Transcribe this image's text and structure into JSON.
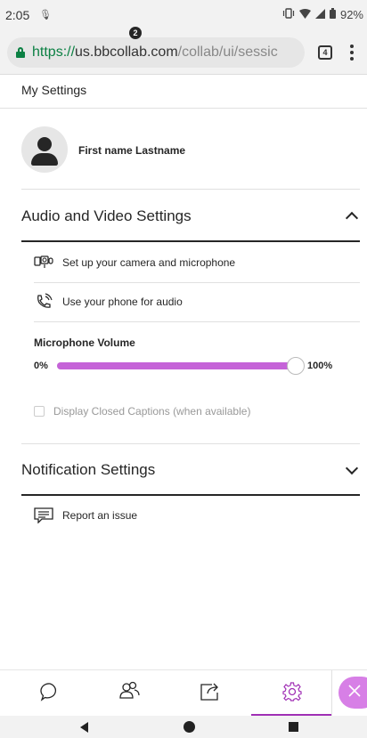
{
  "status_bar": {
    "time": "2:05",
    "battery": "92%"
  },
  "browser": {
    "url_scheme": "https://",
    "url_host": "us.bbcollab.com",
    "url_path": "/collab/ui/sessic",
    "tab_count": "4"
  },
  "settings": {
    "title": "My Settings",
    "user_name": "First name Lastname",
    "audio_video": {
      "title": "Audio and Video Settings",
      "camera_label": "Set up your camera and microphone",
      "phone_label": "Use your phone for audio",
      "mic_volume_label": "Microphone Volume",
      "mic_min": "0%",
      "mic_max": "100%",
      "mic_level": 1.0,
      "captions_label": "Display Closed Captions (when available)"
    },
    "notifications": {
      "title": "Notification Settings",
      "report_label": "Report an issue"
    }
  },
  "bottom_nav": {
    "attendee_badge": "2",
    "active": "settings"
  },
  "colors": {
    "accent": "#a02fb5",
    "slider_fill": "#c563d8",
    "secure_green": "#0b8043"
  }
}
